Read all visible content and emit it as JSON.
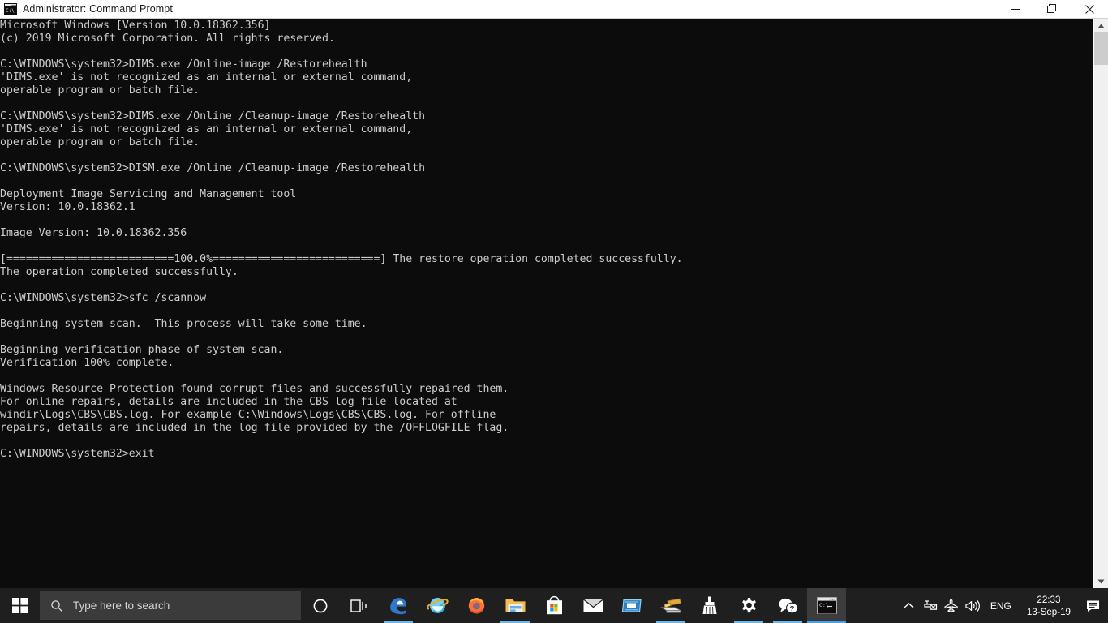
{
  "window": {
    "title": "Administrator: Command Prompt",
    "icon": "cmd-window-icon",
    "minimize_label": "—",
    "maximize_label": "❐",
    "close_label": "✕"
  },
  "console": {
    "background_color": "#0c0c0c",
    "text_color": "#cccccc",
    "prompt": "C:\\WINDOWS\\system32>",
    "lines": [
      "Microsoft Windows [Version 10.0.18362.356]",
      "(c) 2019 Microsoft Corporation. All rights reserved.",
      "",
      "C:\\WINDOWS\\system32>DIMS.exe /Online-image /Restorehealth",
      "'DIMS.exe' is not recognized as an internal or external command,",
      "operable program or batch file.",
      "",
      "C:\\WINDOWS\\system32>DIMS.exe /Online /Cleanup-image /Restorehealth",
      "'DIMS.exe' is not recognized as an internal or external command,",
      "operable program or batch file.",
      "",
      "C:\\WINDOWS\\system32>DISM.exe /Online /Cleanup-image /Restorehealth",
      "",
      "Deployment Image Servicing and Management tool",
      "Version: 10.0.18362.1",
      "",
      "Image Version: 10.0.18362.356",
      "",
      "[==========================100.0%==========================] The restore operation completed successfully.",
      "The operation completed successfully.",
      "",
      "C:\\WINDOWS\\system32>sfc /scannow",
      "",
      "Beginning system scan.  This process will take some time.",
      "",
      "Beginning verification phase of system scan.",
      "Verification 100% complete.",
      "",
      "Windows Resource Protection found corrupt files and successfully repaired them.",
      "For online repairs, details are included in the CBS log file located at",
      "windir\\Logs\\CBS\\CBS.log. For example C:\\Windows\\Logs\\CBS\\CBS.log. For offline",
      "repairs, details are included in the log file provided by the /OFFLOGFILE flag.",
      "",
      "C:\\WINDOWS\\system32>exit"
    ],
    "scrollbar": {
      "up_arrow": "▲",
      "down_arrow": "▼"
    }
  },
  "taskbar": {
    "start_label": "Start",
    "search": {
      "placeholder": "Type here to search",
      "icon": "search-icon"
    },
    "items": [
      {
        "name": "cortana",
        "label": "Cortana",
        "icon": "cortana-circle-icon",
        "running": false
      },
      {
        "name": "task-view",
        "label": "Task View",
        "icon": "task-view-icon",
        "running": false
      },
      {
        "name": "microsoft-edge",
        "label": "Microsoft Edge",
        "icon": "edge-icon",
        "running": true
      },
      {
        "name": "internet-explorer",
        "label": "Internet Explorer",
        "icon": "internet-explorer-icon",
        "running": false
      },
      {
        "name": "firefox",
        "label": "Mozilla Firefox",
        "icon": "firefox-icon",
        "running": false
      },
      {
        "name": "file-explorer",
        "label": "File Explorer",
        "icon": "folder-icon",
        "running": true
      },
      {
        "name": "microsoft-store",
        "label": "Microsoft Store",
        "icon": "store-bag-icon",
        "running": false
      },
      {
        "name": "mail",
        "label": "Mail",
        "icon": "envelope-icon",
        "running": false
      },
      {
        "name": "sticky-notes",
        "label": "Sticky Notes",
        "icon": "blue-window-icon",
        "running": false
      },
      {
        "name": "scanner",
        "label": "Scanner",
        "icon": "scanner-icon",
        "running": true
      },
      {
        "name": "disk-cleanup",
        "label": "Disk Cleanup",
        "icon": "broom-icon",
        "running": false
      },
      {
        "name": "settings",
        "label": "Settings",
        "icon": "gear-icon",
        "running": true
      },
      {
        "name": "get-help",
        "label": "Get Help",
        "icon": "question-chat-icon",
        "running": true
      },
      {
        "name": "command-prompt",
        "label": "Administrator: Command Prompt",
        "icon": "cmd-window-icon",
        "running": true,
        "active": true
      }
    ],
    "tray": {
      "show_hidden_icons": "⌃",
      "network_icon": "network-disconnected-icon",
      "airplane_icon": "airplane-mode-icon",
      "volume_icon": "speaker-icon",
      "language": "ENG",
      "time": "22:33",
      "date": "13-Sep-19",
      "action_center_icon": "action-center-icon"
    }
  }
}
